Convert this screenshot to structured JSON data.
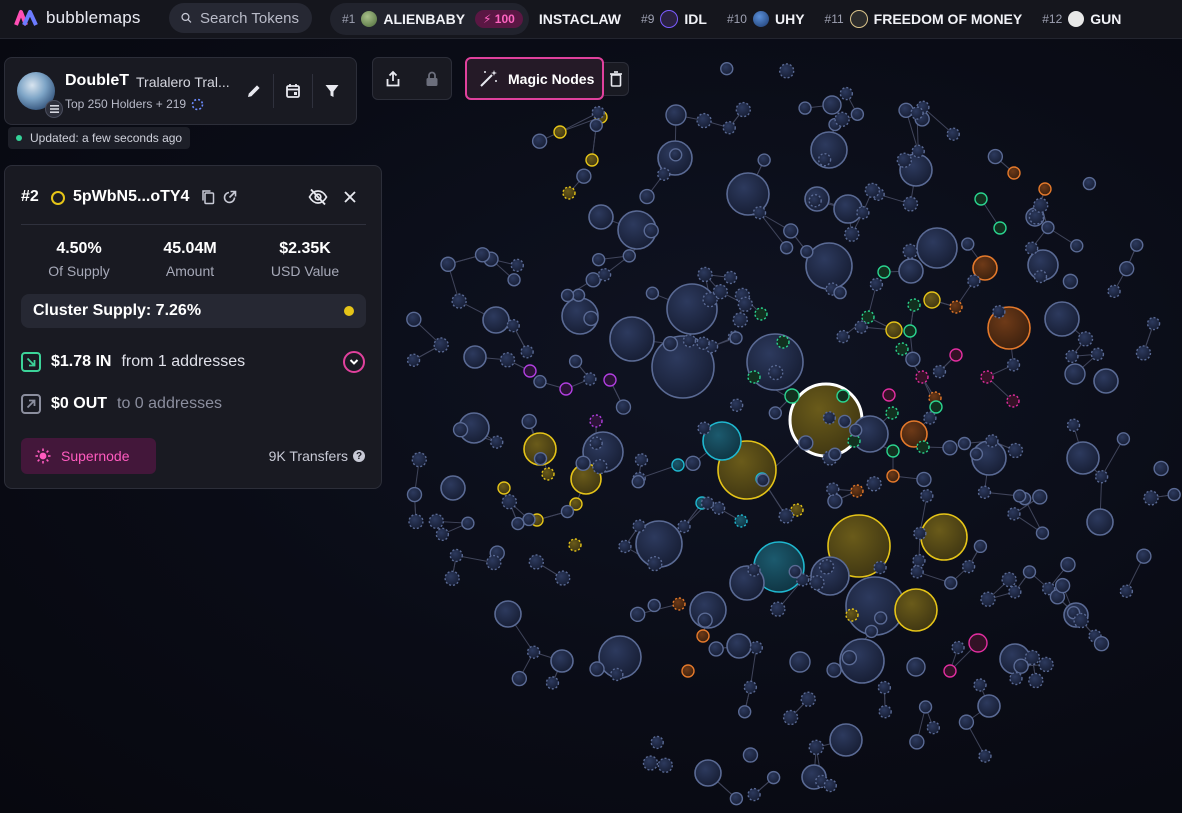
{
  "app": {
    "name": "bubblemaps"
  },
  "search": {
    "placeholder": "Search Tokens"
  },
  "trending": [
    {
      "rank": "#1",
      "name": "ALIENBABY",
      "boost": "100"
    },
    {
      "rank": "",
      "name": "INSTACLAW",
      "boost": ""
    },
    {
      "rank": "#9",
      "name": "IDL",
      "boost": ""
    },
    {
      "rank": "#10",
      "name": "UHY",
      "boost": ""
    },
    {
      "rank": "#11",
      "name": "FREEDOM OF MONEY",
      "boost": ""
    },
    {
      "rank": "#12",
      "name": "GUN",
      "boost": ""
    }
  ],
  "header": {
    "token_name": "DoubleT",
    "token_subtitle": "Tralalero Tral...",
    "holders_text": "Top 250 Holders + 219",
    "updated": "Updated: a few seconds ago"
  },
  "toolbar": {
    "magic_label": "Magic Nodes"
  },
  "details": {
    "rank": "#2",
    "address": "5pWbN5...oTY4",
    "stats": [
      {
        "value": "4.50%",
        "label": "Of Supply"
      },
      {
        "value": "45.04M",
        "label": "Amount"
      },
      {
        "value": "$2.35K",
        "label": "USD Value"
      }
    ],
    "cluster_supply": "Cluster Supply: 7.26%",
    "in_amount": "$1.78 IN",
    "in_from": "from 1 addresses",
    "out_amount": "$0 OUT",
    "out_to": "to 0 addresses",
    "supernode_label": "Supernode",
    "transfers": "9K Transfers"
  },
  "colors": {
    "accent_pink": "#e0419d",
    "cluster_yellow": "#e5c418",
    "node_default": "#1b2541",
    "node_teal": "#1fb7cf",
    "node_orange": "#e4792b",
    "node_green": "#2ad48f",
    "node_purple": "#b13fe0",
    "node_magenta": "#e22ea0"
  }
}
